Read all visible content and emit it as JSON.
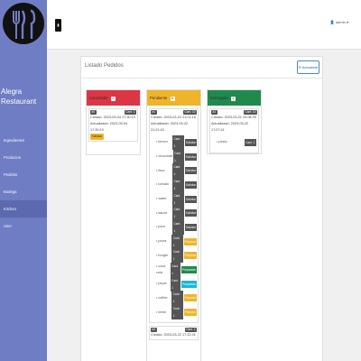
{
  "sidebar": {
    "brand_line1": "Alegra",
    "brand_line2": "Restaurant",
    "items": [
      {
        "label": "Ingredientes"
      },
      {
        "label": "Productos"
      },
      {
        "label": "Pedidos"
      },
      {
        "label": "Bodega"
      },
      {
        "label": "Kitchen"
      },
      {
        "label": "User"
      }
    ]
  },
  "topbar": {
    "user_label": "admin"
  },
  "panel": {
    "title": "Listado Pedidos",
    "refresh_label": "Actualizar"
  },
  "columns": {
    "pending": {
      "title": "Pendiente",
      "count": "6",
      "order": {
        "tag_left": "#1",
        "tag_right": "Cant. 10",
        "created": "Creado: 2023-03-22 21:21:16",
        "updated": "Actualizado: 2023-03-22 21:21:43"
      },
      "items": [
        {
          "name": "lemon",
          "qty": "Cant. 1",
          "status": "Solicitar",
          "color": "#555"
        },
        {
          "name": "chocolate",
          "qty": "Cant. 1",
          "status": "Solicitar",
          "color": "#555"
        },
        {
          "name": "flour",
          "qty": "Cant. 1",
          "status": "Solicitar",
          "color": "#555"
        },
        {
          "name": "tomato",
          "qty": "Cant. 1",
          "status": "Solicitar",
          "color": "#555"
        },
        {
          "name": "water",
          "qty": "Cant. 1",
          "status": "Solicitar",
          "color": "#555"
        },
        {
          "name": "sauce",
          "qty": "Cant. 1",
          "status": "Solicitar",
          "color": "#555"
        },
        {
          "name": "juice",
          "qty": "Cant. 1",
          "status": "Solicitar",
          "color": "#555"
        },
        {
          "name": "pizza",
          "qty": "Cant. 1",
          "status": "Preparar",
          "color": "#f0b429"
        },
        {
          "name": "burger",
          "qty": "Cant. 1",
          "status": "Preparar",
          "color": "#f0b429"
        },
        {
          "name": "coca cola",
          "qty": "Cant. 1",
          "status": "Preparado",
          "color": "#1f8a4c"
        },
        {
          "name": "pepsi",
          "qty": "Cant. 1",
          "status": "Preparado",
          "color": "#17b8d6"
        },
        {
          "name": "coffee",
          "qty": "Cant. 1",
          "status": "Preparar",
          "color": "#f0b429"
        },
        {
          "name": "drink",
          "qty": "Cant. 1",
          "status": "Preparar",
          "color": "#f0b429"
        }
      ],
      "order2": {
        "tag_left": "#3",
        "tag_right": "Cant. 1",
        "created": "Creado: 2023-03-22 17:22:41"
      }
    },
    "cancelled": {
      "title": "Cancelado",
      "count": "1",
      "order": {
        "tag_left": "#0",
        "tag_right": "Cant. 1",
        "created": "Creado: 2023-03-04 17:30:19",
        "updated": "Actualizado: 2023-03-04 17:30:19",
        "button": "Solicitar"
      }
    },
    "delivered": {
      "title": "Entregado",
      "count": "1",
      "order": {
        "tag_left": "#2",
        "tag_right": "Cant. 10",
        "created": "Creado: 2023-03-21 20:08:39",
        "updated": "Actualizado: 2023-03-22 17:07:41"
      },
      "items": [
        {
          "name": "pesto",
          "qty": "Cant. 1"
        }
      ]
    }
  }
}
